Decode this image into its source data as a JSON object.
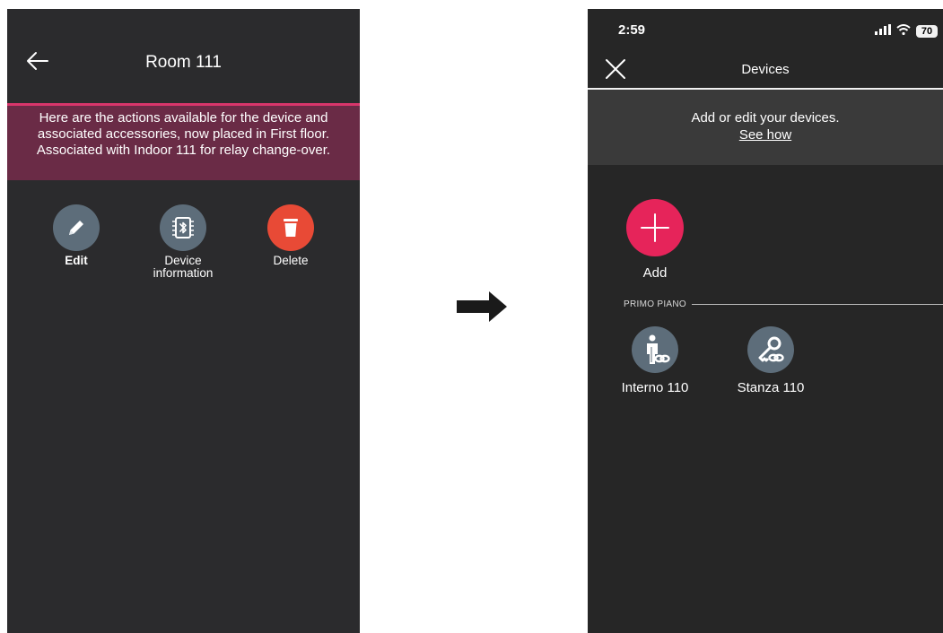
{
  "left_screen": {
    "title": "Room 111",
    "back_icon": "arrow-left-icon",
    "banner_text": "Here are the actions available for the device and associated accessories, now placed in First floor. Associated with Indoor 111 for relay change-over.",
    "banner_color": "#6a2b46",
    "banner_accent": "#d8366b",
    "actions": [
      {
        "label": "Edit",
        "icon": "pencil-icon",
        "color": "#5d6d7a"
      },
      {
        "label_line1": "Device",
        "label_line2": "information",
        "icon": "bluetooth-chip-icon",
        "color": "#5d6d7a"
      },
      {
        "label": "Delete",
        "icon": "trash-icon",
        "color": "#e84a36"
      }
    ]
  },
  "transition_icon": "right-arrow-icon",
  "right_screen": {
    "status_bar": {
      "time": "2:59",
      "battery": "70"
    },
    "title": "Devices",
    "close_icon": "close-icon",
    "help_text": "Add or edit your devices.",
    "help_link": "See how",
    "add_label": "Add",
    "add_color": "#e6245a",
    "section_label": "PRIMO PIANO",
    "devices": [
      {
        "label": "Interno 110",
        "icon": "person-link-icon"
      },
      {
        "label": "Stanza 110",
        "icon": "key-link-icon"
      }
    ]
  }
}
